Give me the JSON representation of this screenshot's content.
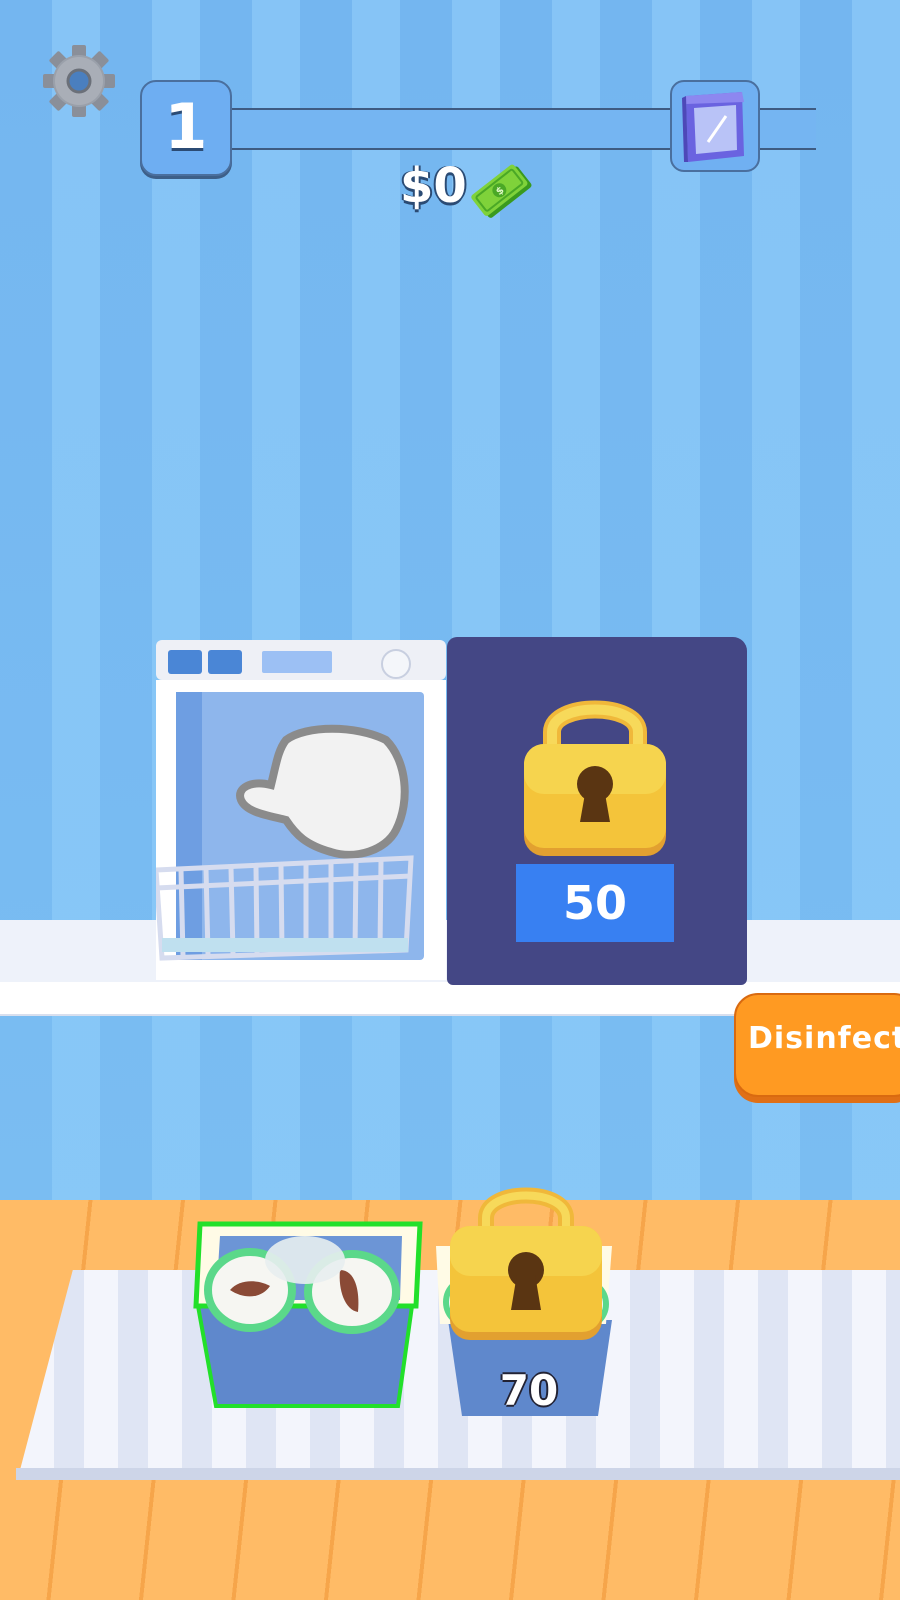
{
  "hud": {
    "level": "1",
    "money": "$0",
    "settings_icon": "gear-icon",
    "goal_icon": "dishwasher-icon",
    "cash_icon": "cash-icon"
  },
  "stations": {
    "locked_machine_price": "50",
    "locked_basket_price": "70"
  },
  "buttons": {
    "disinfect_label": "Disinfect"
  },
  "colors": {
    "accent_orange": "#ff9a22",
    "lock_gold": "#f4c43a",
    "price_blue": "#3880f2",
    "machine_navy": "#444785",
    "highlight_green": "#22e02a"
  }
}
